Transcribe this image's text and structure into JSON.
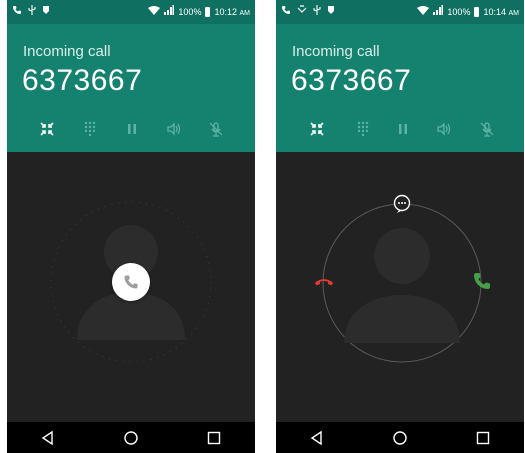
{
  "screens": [
    {
      "status": {
        "battery": "100%",
        "time": "10:12",
        "ampm": "AM"
      },
      "call": {
        "label": "Incoming call",
        "number": "6373667"
      }
    },
    {
      "status": {
        "battery": "100%",
        "time": "10:14",
        "ampm": "AM"
      },
      "call": {
        "label": "Incoming call",
        "number": "6373667"
      }
    }
  ],
  "colors": {
    "header": "#14826f",
    "statusbar": "#0f6f60",
    "background": "#222222",
    "decline": "#e53935",
    "answer": "#43a047"
  },
  "icons": {
    "controls": [
      "collapse-icon",
      "dialpad-icon",
      "pause-icon",
      "speaker-icon",
      "mute-icon"
    ],
    "navbar": [
      "back-icon",
      "home-icon",
      "recents-icon"
    ],
    "status_left": [
      "call-icon",
      "usb-icon",
      "notification-icon"
    ],
    "status_right": [
      "wifi-icon",
      "signal-icon",
      "battery-icon"
    ]
  }
}
